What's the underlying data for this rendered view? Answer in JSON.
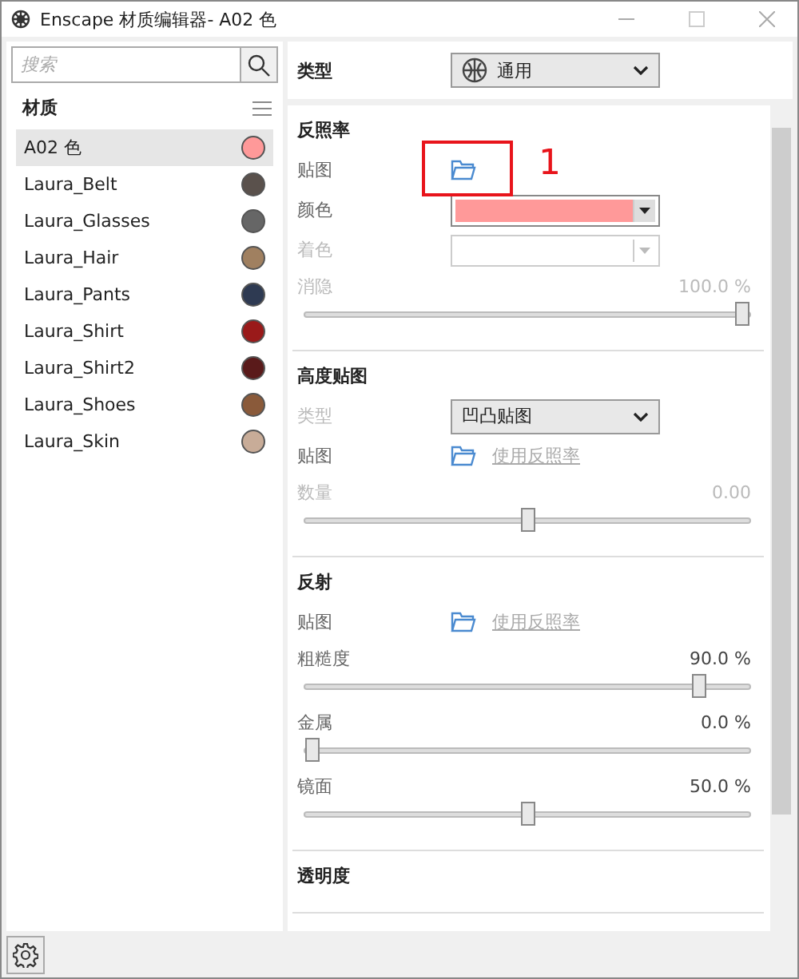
{
  "window": {
    "title": "Enscape 材质编辑器- A02 色"
  },
  "search": {
    "placeholder": "搜索"
  },
  "materials": {
    "heading": "材质",
    "items": [
      {
        "name": "A02 色",
        "color": "#ff9999",
        "selected": true
      },
      {
        "name": "Laura_Belt",
        "color": "#5a514c",
        "selected": false
      },
      {
        "name": "Laura_Glasses",
        "color": "#666666",
        "selected": false
      },
      {
        "name": "Laura_Hair",
        "color": "#a08060",
        "selected": false
      },
      {
        "name": "Laura_Pants",
        "color": "#2e3a52",
        "selected": false
      },
      {
        "name": "Laura_Shirt",
        "color": "#9a1a1a",
        "selected": false
      },
      {
        "name": "Laura_Shirt2",
        "color": "#5a1a1a",
        "selected": false
      },
      {
        "name": "Laura_Shoes",
        "color": "#8a5a3a",
        "selected": false
      },
      {
        "name": "Laura_Skin",
        "color": "#c8ac98",
        "selected": false
      }
    ]
  },
  "type_row": {
    "label": "类型",
    "value": "通用"
  },
  "sections": [
    {
      "title": "反照率",
      "rows": [
        {
          "kind": "texture",
          "label": "贴图",
          "disabled": false,
          "annotation": "1"
        },
        {
          "kind": "color",
          "label": "颜色",
          "disabled": false,
          "color": "#ff9999"
        },
        {
          "kind": "color",
          "label": "着色",
          "disabled": true
        },
        {
          "kind": "slider",
          "label": "消隐",
          "disabled": true,
          "value": "100.0",
          "unit": "%",
          "level": 1
        }
      ]
    },
    {
      "title": "高度贴图",
      "rows": [
        {
          "kind": "dropdown",
          "label": "类型",
          "disabled": true,
          "value": "凹凸贴图"
        },
        {
          "kind": "texture",
          "label": "贴图",
          "disabled": false,
          "link": "使用反照率"
        },
        {
          "kind": "slider",
          "label": "数量",
          "disabled": true,
          "value": "0.00",
          "level": 0.5
        }
      ]
    },
    {
      "title": "反射",
      "rows": [
        {
          "kind": "texture",
          "label": "贴图",
          "disabled": false,
          "link": "使用反照率"
        },
        {
          "kind": "slider",
          "label": "粗糙度",
          "disabled": false,
          "value": "90.0",
          "unit": "%",
          "level": 0.9
        },
        {
          "kind": "slider",
          "label": "金属",
          "disabled": false,
          "value": "0.0",
          "unit": "%",
          "level": 0
        },
        {
          "kind": "slider",
          "label": "镜面",
          "disabled": false,
          "value": "50.0",
          "unit": "%",
          "level": 0.5
        }
      ]
    },
    {
      "title": "透明度"
    }
  ]
}
